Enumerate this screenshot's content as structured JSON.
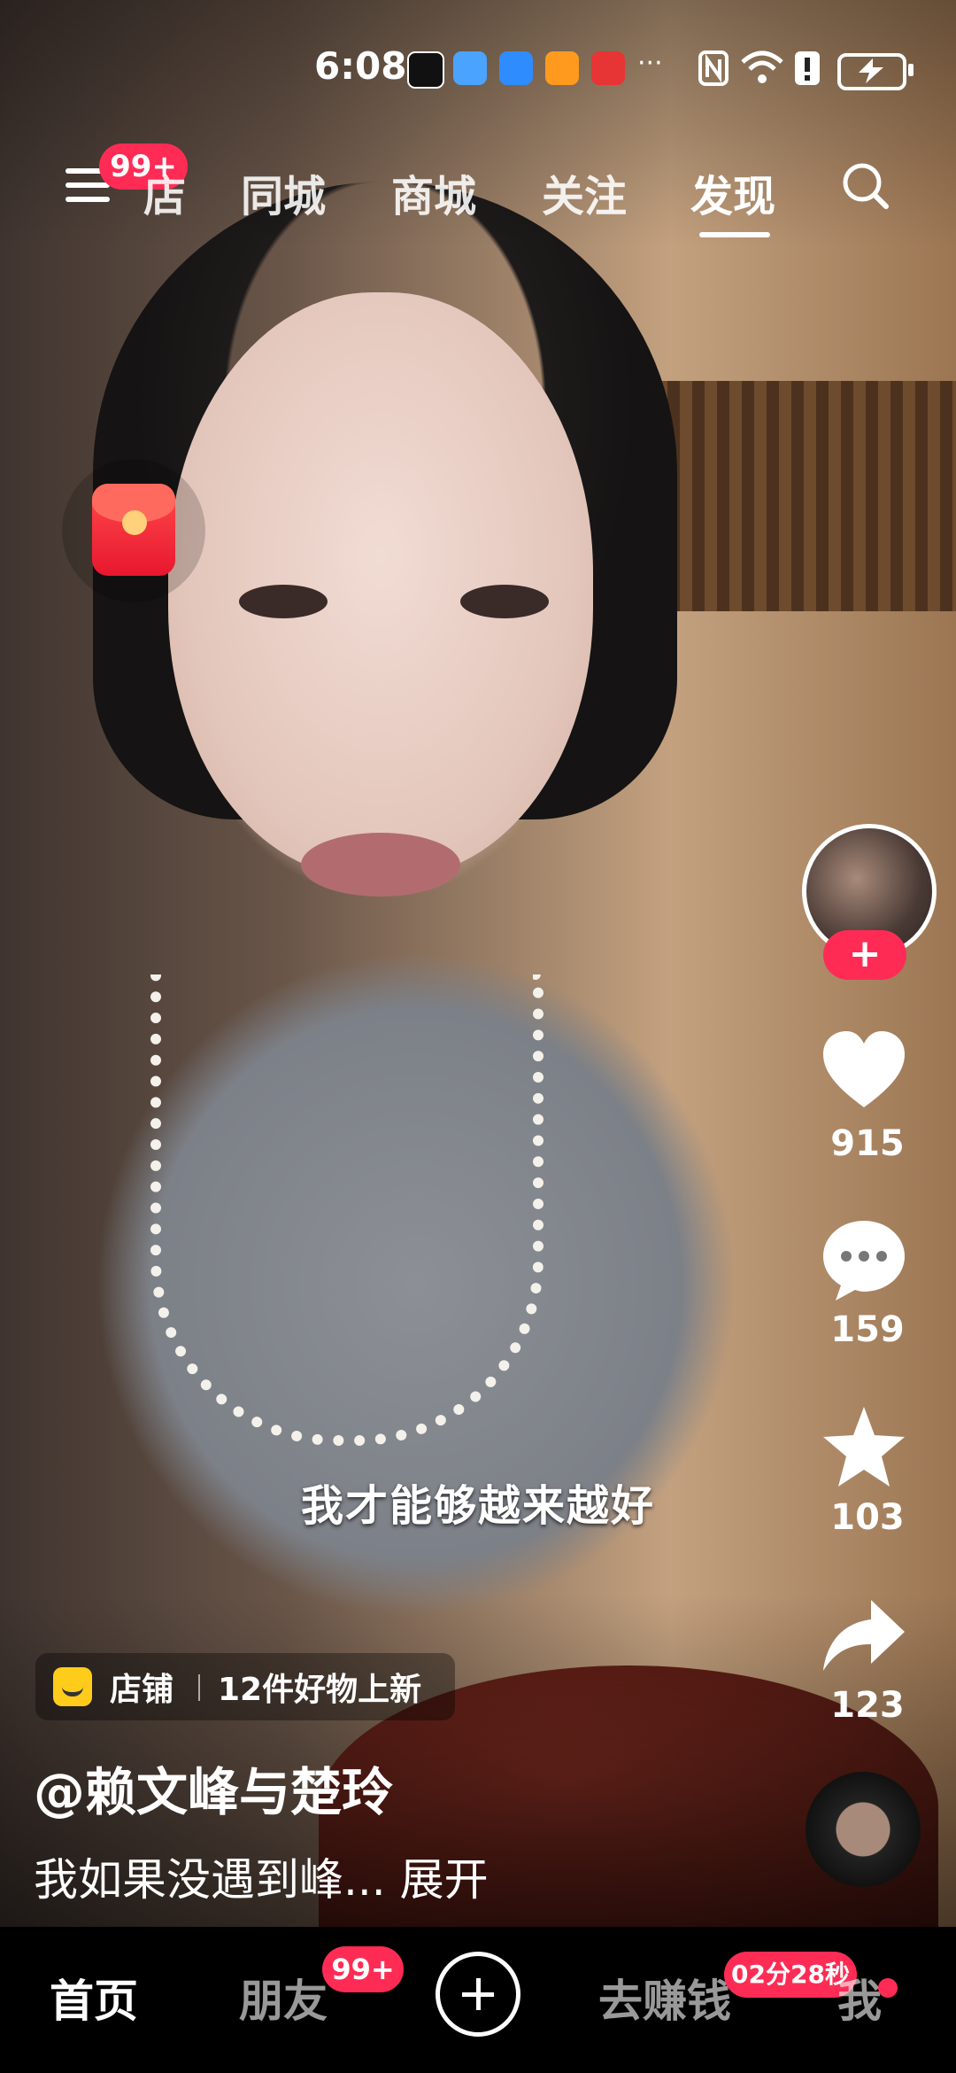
{
  "status_bar": {
    "time": "6:08",
    "more": "···"
  },
  "top_nav": {
    "menu_badge": "99+",
    "tabs": [
      {
        "label": "店"
      },
      {
        "label": "同城"
      },
      {
        "label": "商城"
      },
      {
        "label": "关注"
      },
      {
        "label": "发现"
      }
    ],
    "active_tab": "发现"
  },
  "right_rail": {
    "like_count": "915",
    "comment_count": "159",
    "favorite_count": "103",
    "share_count": "123"
  },
  "video": {
    "subtitle": "我才能够越来越好",
    "shop": {
      "label": "店铺",
      "promo": "12件好物上新"
    },
    "author": "@赖文峰与楚玲",
    "caption": "我如果没遇到峰... 展开"
  },
  "bottom_nav": {
    "items": [
      {
        "label": "首页"
      },
      {
        "label": "朋友",
        "badge": "99+"
      },
      {
        "label": "去赚钱",
        "badge": "02分28秒"
      },
      {
        "label": "我"
      }
    ]
  },
  "colors": {
    "accent": "#fe2c55",
    "shop_icon": "#ffcc1b"
  }
}
